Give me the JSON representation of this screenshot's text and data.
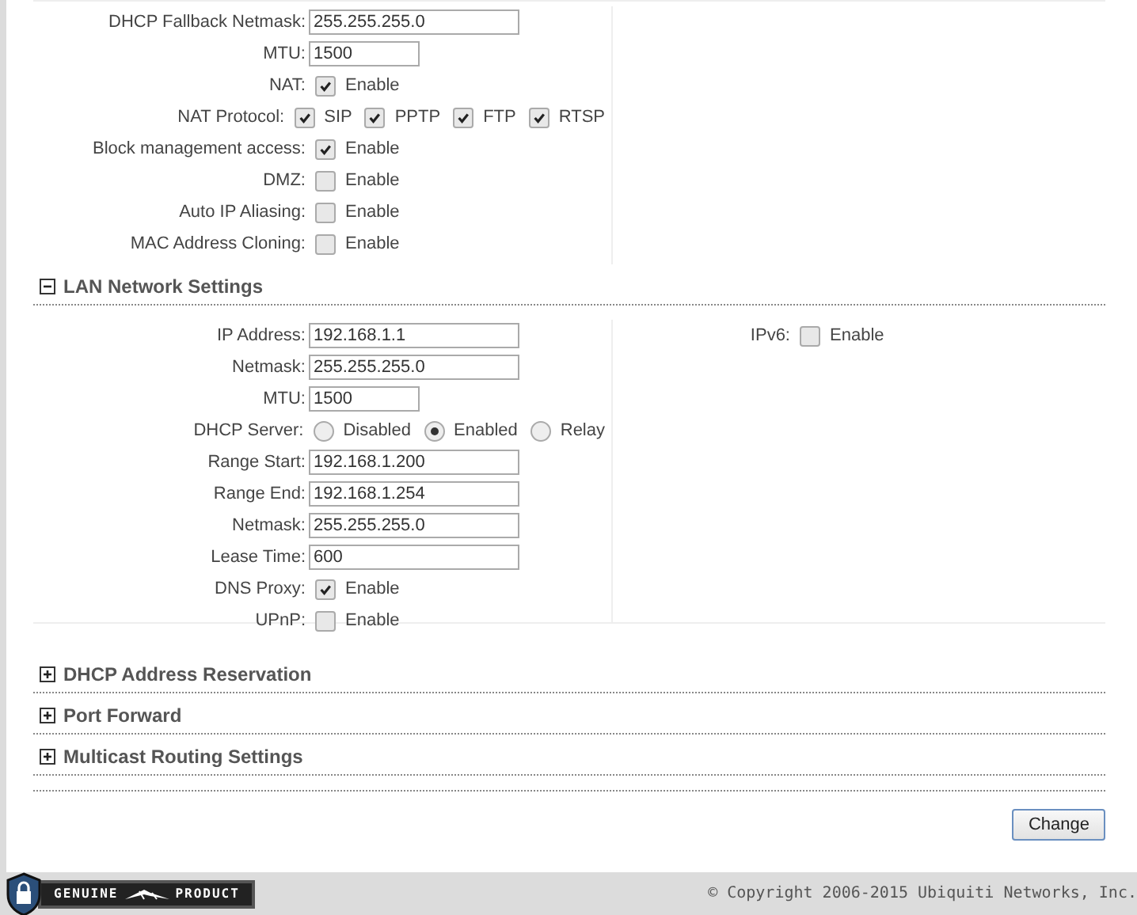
{
  "wan_rows": [
    {
      "label": "DHCP Fallback Netmask:",
      "kind": "text",
      "value": "255.255.255.0"
    },
    {
      "label": "MTU:",
      "kind": "short_text",
      "value": "1500"
    },
    {
      "label": "NAT:",
      "kind": "check",
      "options": [
        {
          "label": "Enable",
          "checked": true
        }
      ]
    },
    {
      "label": "NAT Protocol:",
      "kind": "check",
      "options": [
        {
          "label": "SIP",
          "checked": true
        },
        {
          "label": "PPTP",
          "checked": true
        },
        {
          "label": "FTP",
          "checked": true
        },
        {
          "label": "RTSP",
          "checked": true
        }
      ]
    },
    {
      "label": "Block management access:",
      "kind": "check",
      "options": [
        {
          "label": "Enable",
          "checked": true
        }
      ]
    },
    {
      "label": "DMZ:",
      "kind": "check",
      "options": [
        {
          "label": "Enable",
          "checked": false
        }
      ]
    },
    {
      "label": "Auto IP Aliasing:",
      "kind": "check",
      "options": [
        {
          "label": "Enable",
          "checked": false
        }
      ]
    },
    {
      "label": "MAC Address Cloning:",
      "kind": "check",
      "options": [
        {
          "label": "Enable",
          "checked": false
        }
      ]
    }
  ],
  "lan": {
    "title": "LAN Network Settings",
    "expanded": true,
    "rows": [
      {
        "label": "IP Address:",
        "kind": "text",
        "value": "192.168.1.1"
      },
      {
        "label": "Netmask:",
        "kind": "text",
        "value": "255.255.255.0"
      },
      {
        "label": "MTU:",
        "kind": "short_text",
        "value": "1500"
      },
      {
        "label": "DHCP Server:",
        "kind": "radio",
        "options": [
          {
            "label": "Disabled",
            "selected": false
          },
          {
            "label": "Enabled",
            "selected": true
          },
          {
            "label": "Relay",
            "selected": false
          }
        ]
      },
      {
        "label": "Range Start:",
        "kind": "text",
        "value": "192.168.1.200"
      },
      {
        "label": "Range End:",
        "kind": "text",
        "value": "192.168.1.254"
      },
      {
        "label": "Netmask:",
        "kind": "text",
        "value": "255.255.255.0"
      },
      {
        "label": "Lease Time:",
        "kind": "text",
        "value": "600"
      },
      {
        "label": "DNS Proxy:",
        "kind": "check",
        "options": [
          {
            "label": "Enable",
            "checked": true
          }
        ]
      },
      {
        "label": "UPnP:",
        "kind": "check",
        "options": [
          {
            "label": "Enable",
            "checked": false
          }
        ]
      }
    ],
    "side_rows": [
      {
        "label": "IPv6:",
        "kind": "check",
        "options": [
          {
            "label": "Enable",
            "checked": false
          }
        ]
      }
    ]
  },
  "sections": [
    {
      "title": "DHCP Address Reservation",
      "expanded": false
    },
    {
      "title": "Port Forward",
      "expanded": false
    },
    {
      "title": "Multicast Routing Settings",
      "expanded": false
    }
  ],
  "change_button": "Change",
  "footer": {
    "badge_left": "GENUINE",
    "badge_right": "PRODUCT",
    "copyright": "© Copyright 2006-2015 Ubiquiti Networks, Inc."
  }
}
